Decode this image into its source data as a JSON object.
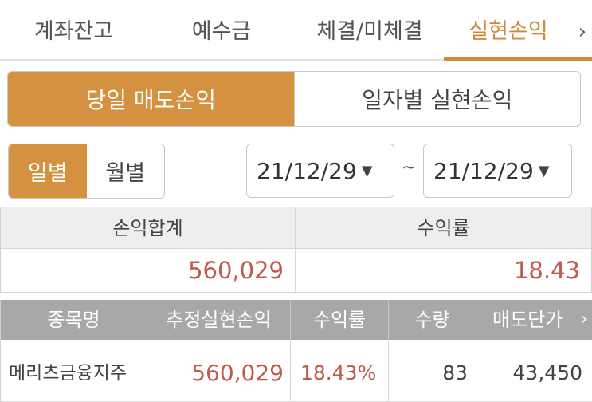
{
  "tabs": [
    {
      "label": "계좌잔고",
      "active": false
    },
    {
      "label": "예수금",
      "active": false
    },
    {
      "label": "체결/미체결",
      "active": false
    },
    {
      "label": "실현손익",
      "active": true
    }
  ],
  "tab_next_icon": "chevron-right-icon",
  "tab_next_glyph": "›",
  "mode_toggle": {
    "left": "당일 매도손익",
    "right": "일자별 실현손익",
    "active": "left"
  },
  "period_toggle": {
    "day": "일별",
    "month": "월별",
    "active": "day"
  },
  "date_range": {
    "from": "21/12/29",
    "to": "21/12/29",
    "separator": "~",
    "caret": "▼"
  },
  "summary": {
    "headers": [
      "손익합계",
      "수익률"
    ],
    "values": [
      "560,029",
      "18.43"
    ]
  },
  "detail": {
    "headers": [
      "종목명",
      "추정실현손익",
      "수익률",
      "수량",
      "매도단가"
    ],
    "more_glyph": "›",
    "rows": [
      {
        "name": "메리츠금융지주",
        "profit": "560,029",
        "rate": "18.43%",
        "qty": "83",
        "price": "43,450"
      }
    ]
  },
  "colors": {
    "accent": "#d4913f",
    "tab_active": "#d18a3b",
    "profit_red": "#c15a4a",
    "header_gray": "#a8a8a8"
  }
}
